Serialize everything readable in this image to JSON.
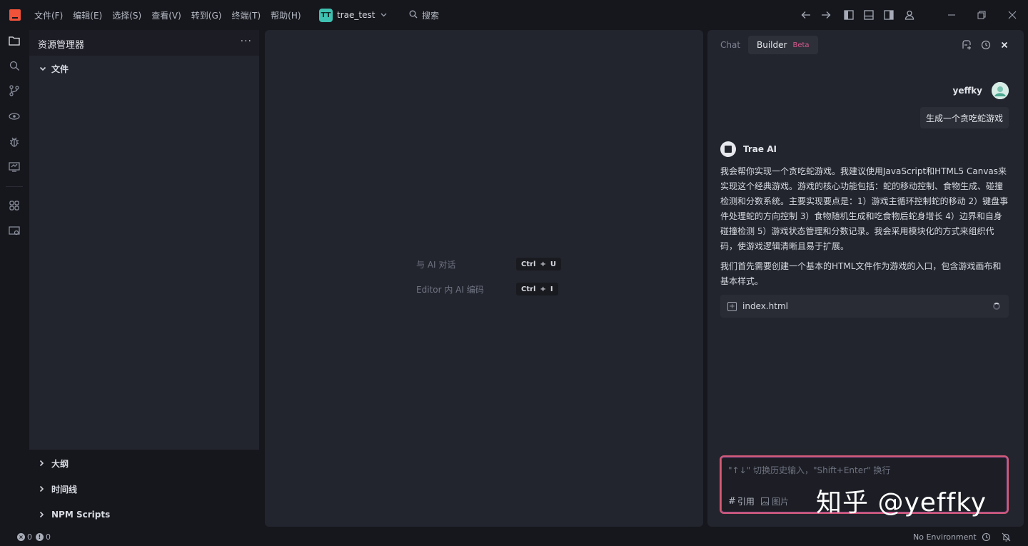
{
  "menu": [
    "文件(F)",
    "编辑(E)",
    "选择(S)",
    "查看(V)",
    "转到(G)",
    "终端(T)",
    "帮助(H)"
  ],
  "project": {
    "badge": "TT",
    "name": "trae_test"
  },
  "search": {
    "label": "搜索"
  },
  "sidebar": {
    "title": "资源管理器",
    "more": "···",
    "sections": {
      "files": "文件",
      "outline": "大纲",
      "timeline": "时间线",
      "npm": "NPM Scripts"
    }
  },
  "editor": {
    "hint_chat": {
      "label": "与 AI 对话",
      "key1": "Ctrl",
      "plus": "+",
      "key2": "U"
    },
    "hint_inline": {
      "label": "Editor 内 AI 编码",
      "key1": "Ctrl",
      "plus": "+",
      "key2": "I"
    }
  },
  "ai_panel": {
    "tabs": {
      "chat": "Chat",
      "builder": "Builder",
      "badge": "Beta"
    },
    "user": {
      "name": "yeffky",
      "message": "生成一个贪吃蛇游戏"
    },
    "assistant": {
      "name": "Trae AI",
      "paragraph1": "我会帮你实现一个贪吃蛇游戏。我建议使用JavaScript和HTML5 Canvas来实现这个经典游戏。游戏的核心功能包括：蛇的移动控制、食物生成、碰撞检测和分数系统。主要实现要点是：1）游戏主循环控制蛇的移动 2）键盘事件处理蛇的方向控制 3）食物随机生成和吃食物后蛇身增长 4）边界和自身碰撞检测 5）游戏状态管理和分数记录。我会采用模块化的方式来组织代码，使游戏逻辑清晰且易于扩展。",
      "paragraph2": "我们首先需要创建一个基本的HTML文件作为游戏的入口，包含游戏画布和基本样式。",
      "file": "index.html"
    },
    "input": {
      "placeholder": "\"↑↓\" 切换历史输入，\"Shift+Enter\" 换行",
      "ref": "引用",
      "image": "图片"
    }
  },
  "watermark": "知乎 @yeffky",
  "status": {
    "errors": "0",
    "warnings": "0",
    "environment": "No Environment"
  },
  "colors": {
    "accent_red": "#f0523a",
    "project_teal": "#3ec1b0",
    "beta_pink": "#d6588e",
    "input_border": "#d15b77"
  }
}
